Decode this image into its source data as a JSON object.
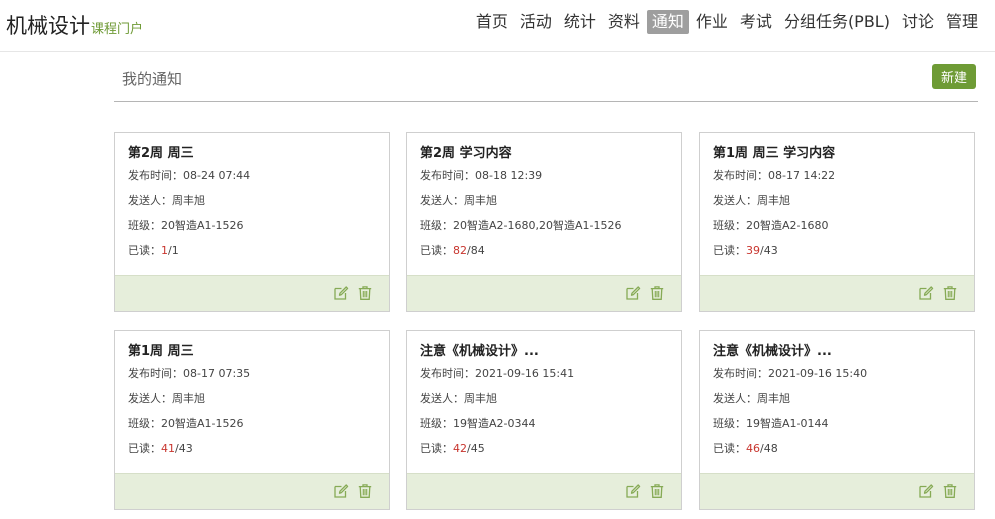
{
  "app": {
    "title": "机械设计",
    "subtitle": "课程门户"
  },
  "nav": {
    "items": [
      "首页",
      "活动",
      "统计",
      "资料",
      "通知",
      "作业",
      "考试",
      "分组任务(PBL)",
      "讨论",
      "管理"
    ],
    "active_index": 4
  },
  "page": {
    "heading": "我的通知",
    "new_button": "新建"
  },
  "labels": {
    "publish_time": "发布时间：",
    "sender": "发送人：",
    "class": "班级：",
    "read": "已读："
  },
  "colors": {
    "accent": "#6e9b35",
    "read_count": "#c8352e",
    "card_footer": "#e6eedb"
  },
  "cards": [
    {
      "title": "第2周 周三",
      "publish_time": "08-24 07:44",
      "sender": "周丰旭",
      "class": "20智造A1-1526",
      "read": "1",
      "total": "/1"
    },
    {
      "title": "第2周 学习内容",
      "publish_time": "08-18 12:39",
      "sender": "周丰旭",
      "class": "20智造A2-1680,20智造A1-1526",
      "read": "82",
      "total": "/84"
    },
    {
      "title": "第1周 周三 学习内容",
      "publish_time": "08-17 14:22",
      "sender": "周丰旭",
      "class": "20智造A2-1680",
      "read": "39",
      "total": "/43"
    },
    {
      "title": "第1周 周三",
      "publish_time": "08-17 07:35",
      "sender": "周丰旭",
      "class": "20智造A1-1526",
      "read": "41",
      "total": "/43"
    },
    {
      "title": "注意《机械设计》...",
      "publish_time": "2021-09-16 15:41",
      "sender": "周丰旭",
      "class": "19智造A2-0344",
      "read": "42",
      "total": "/45"
    },
    {
      "title": "注意《机械设计》...",
      "publish_time": "2021-09-16 15:40",
      "sender": "周丰旭",
      "class": "19智造A1-0144",
      "read": "46",
      "total": "/48"
    }
  ]
}
